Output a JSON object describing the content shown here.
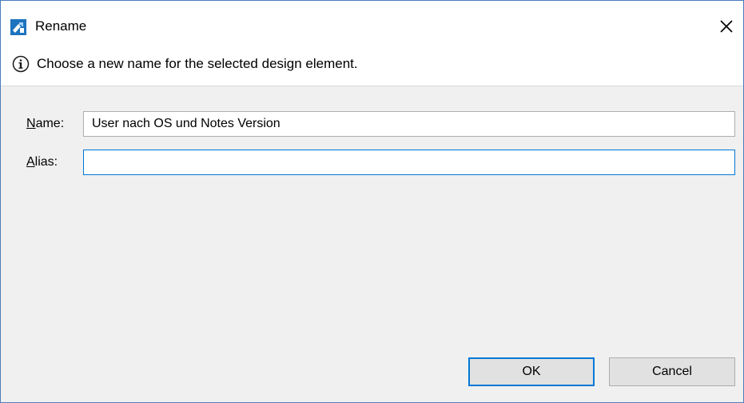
{
  "window": {
    "title": "Rename",
    "icon": "app-rename-icon",
    "close_glyph": "✕"
  },
  "message": {
    "icon": "info-icon",
    "text": "Choose a new name for the selected design element."
  },
  "form": {
    "name": {
      "label_mnemonic": "N",
      "label_rest": "ame:",
      "value": "User nach OS und Notes Version"
    },
    "alias": {
      "label_mnemonic": "A",
      "label_rest": "lias:",
      "value": ""
    }
  },
  "buttons": {
    "ok_label": "OK",
    "cancel_label": "Cancel"
  },
  "colors": {
    "accent": "#0078d7",
    "window_border": "#4a7ebb",
    "background": "#f0f0f0"
  }
}
